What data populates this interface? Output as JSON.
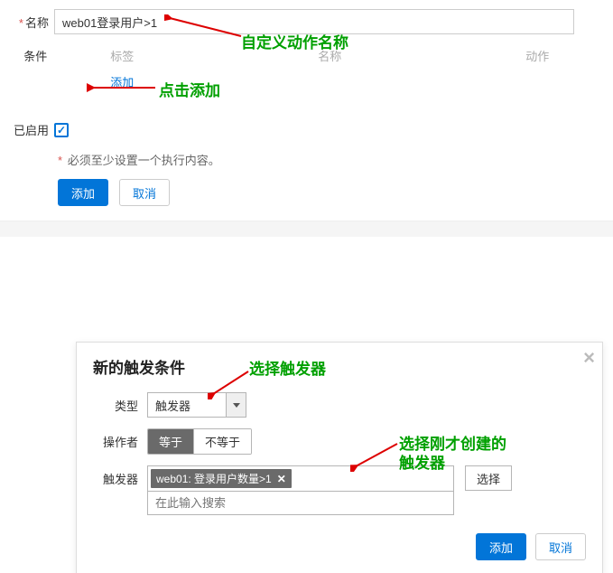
{
  "form": {
    "name_label": "名称",
    "name_value": "web01登录用户>1",
    "cond_label": "条件",
    "col_tag": "标签",
    "col_name": "名称",
    "col_action": "动作",
    "add_link": "添加",
    "enabled_label": "已启用",
    "warn_text": "必须至少设置一个执行内容。",
    "btn_add": "添加",
    "btn_cancel": "取消"
  },
  "modal": {
    "title": "新的触发条件",
    "type_label": "类型",
    "type_value": "触发器",
    "op_label": "操作者",
    "op_eq": "等于",
    "op_neq": "不等于",
    "trigger_label": "触发器",
    "trigger_tag": "web01: 登录用户数量>1",
    "search_placeholder": "在此输入搜索",
    "choose": "选择",
    "btn_add": "添加",
    "btn_cancel": "取消"
  },
  "anno": {
    "a1": "自定义动作名称",
    "a2": "点击添加",
    "a3": "选择触发器",
    "a4": "选择刚才创建的",
    "a5": "触发器"
  }
}
